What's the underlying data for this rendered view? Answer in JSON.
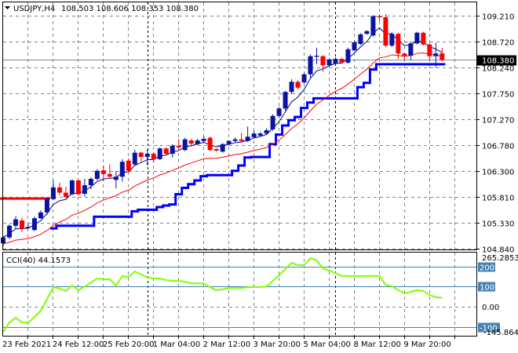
{
  "header": {
    "symbol": "USDJPY,H4",
    "ohlc": "108.503 108.606 108.353 108.380",
    "menu_icon": "triangle-down-icon"
  },
  "colors": {
    "bull": "#0a14a0",
    "bear": "#ff0000",
    "fast_ma": "#000080",
    "slow_ma": "#ff0000",
    "stop_lower": "#0000ff",
    "stop_upper": "#ff0000",
    "cci": "#80ff00",
    "level": "#4682b4",
    "grid": "#7a8594",
    "price_line": "#7a8a9a"
  },
  "chart_data": [
    {
      "type": "candlestick",
      "title": "USDJPY,H4",
      "ylim": [
        104.84,
        109.21
      ],
      "y_ticks": [
        "109.210",
        "108.720",
        "108.240",
        "107.750",
        "107.270",
        "106.780",
        "106.300",
        "105.810",
        "105.330",
        "104.840"
      ],
      "current_price": "108.380",
      "x_labels": [
        {
          "index": 0,
          "text": "23 Feb 2021"
        },
        {
          "index": 8,
          "text": "24 Feb 12:00"
        },
        {
          "index": 16,
          "text": "25 Feb 20:00"
        },
        {
          "index": 24,
          "text": "1 Mar 04:00"
        },
        {
          "index": 32,
          "text": "2 Mar 12:00"
        },
        {
          "index": 40,
          "text": "3 Mar 20:00"
        },
        {
          "index": 48,
          "text": "5 Mar 04:00"
        },
        {
          "index": 56,
          "text": "8 Mar 12:00"
        },
        {
          "index": 64,
          "text": "9 Mar 20:00"
        }
      ],
      "period_separators": [
        23,
        53
      ],
      "candles_ohlc": [
        [
          104.94,
          105.08,
          104.88,
          105.05
        ],
        [
          105.05,
          105.3,
          105.02,
          105.27
        ],
        [
          105.27,
          105.45,
          105.22,
          105.39
        ],
        [
          105.37,
          105.42,
          105.15,
          105.22
        ],
        [
          105.23,
          105.3,
          105.21,
          105.25
        ],
        [
          105.19,
          105.44,
          105.17,
          105.41
        ],
        [
          105.41,
          105.56,
          105.4,
          105.52
        ],
        [
          105.52,
          105.8,
          105.48,
          105.78
        ],
        [
          105.77,
          106.12,
          105.75,
          105.99
        ],
        [
          105.99,
          106.08,
          105.85,
          105.89
        ],
        [
          105.89,
          106.0,
          105.79,
          105.81
        ],
        [
          105.86,
          106.14,
          105.84,
          106.12
        ],
        [
          106.12,
          106.14,
          105.84,
          105.86
        ],
        [
          105.87,
          106.15,
          105.82,
          106.03
        ],
        [
          106.03,
          106.18,
          105.95,
          106.15
        ],
        [
          106.15,
          106.33,
          106.12,
          106.3
        ],
        [
          106.31,
          106.4,
          106.1,
          106.24
        ],
        [
          106.24,
          106.42,
          106.15,
          106.19
        ],
        [
          106.13,
          106.3,
          105.97,
          106.19
        ],
        [
          106.19,
          106.52,
          106.1,
          106.47
        ],
        [
          106.49,
          106.53,
          106.27,
          106.3
        ],
        [
          106.42,
          106.7,
          106.4,
          106.64
        ],
        [
          106.64,
          106.66,
          106.47,
          106.56
        ],
        [
          106.56,
          106.7,
          106.4,
          106.62
        ],
        [
          106.62,
          106.65,
          106.45,
          106.52
        ],
        [
          106.52,
          106.74,
          106.5,
          106.72
        ],
        [
          106.72,
          106.74,
          106.6,
          106.62
        ],
        [
          106.62,
          106.8,
          106.55,
          106.77
        ],
        [
          106.77,
          106.9,
          106.7,
          106.74
        ],
        [
          106.69,
          106.92,
          106.67,
          106.89
        ],
        [
          106.87,
          106.9,
          106.75,
          106.81
        ],
        [
          106.8,
          106.9,
          106.78,
          106.87
        ],
        [
          106.86,
          106.95,
          106.84,
          106.9
        ],
        [
          106.92,
          106.94,
          106.67,
          106.69
        ],
        [
          106.71,
          106.72,
          106.66,
          106.68
        ],
        [
          106.66,
          106.82,
          106.64,
          106.8
        ],
        [
          106.8,
          106.88,
          106.78,
          106.86
        ],
        [
          106.86,
          106.93,
          106.84,
          106.89
        ],
        [
          106.89,
          107.01,
          106.84,
          106.86
        ],
        [
          106.86,
          107.13,
          106.84,
          106.94
        ],
        [
          106.93,
          107.05,
          106.91,
          107.0
        ],
        [
          106.96,
          107.03,
          106.94,
          107.0
        ],
        [
          107.0,
          107.1,
          106.98,
          107.06
        ],
        [
          107.08,
          107.36,
          107.05,
          107.33
        ],
        [
          107.33,
          107.5,
          107.3,
          107.47
        ],
        [
          107.47,
          107.8,
          107.43,
          107.78
        ],
        [
          107.78,
          108.02,
          107.74,
          107.97
        ],
        [
          107.97,
          108.0,
          107.82,
          107.86
        ],
        [
          107.96,
          108.14,
          107.93,
          108.11
        ],
        [
          108.11,
          108.48,
          108.05,
          108.45
        ],
        [
          108.44,
          108.61,
          108.3,
          108.46
        ],
        [
          108.45,
          108.47,
          108.16,
          108.28
        ],
        [
          108.28,
          108.41,
          108.26,
          108.39
        ],
        [
          108.31,
          108.43,
          108.29,
          108.4
        ],
        [
          108.4,
          108.42,
          108.31,
          108.33
        ],
        [
          108.33,
          108.61,
          108.31,
          108.58
        ],
        [
          108.56,
          108.74,
          108.54,
          108.71
        ],
        [
          108.68,
          108.88,
          108.66,
          108.86
        ],
        [
          108.87,
          108.94,
          108.85,
          108.92
        ],
        [
          108.84,
          109.22,
          108.82,
          109.2
        ],
        [
          109.2,
          109.24,
          109.1,
          109.18
        ],
        [
          109.18,
          109.24,
          108.62,
          108.65
        ],
        [
          108.65,
          108.9,
          108.62,
          108.87
        ],
        [
          108.87,
          108.89,
          108.4,
          108.5
        ],
        [
          108.5,
          108.52,
          108.38,
          108.46
        ],
        [
          108.46,
          108.72,
          108.38,
          108.69
        ],
        [
          108.69,
          108.91,
          108.67,
          108.89
        ],
        [
          108.89,
          108.91,
          108.65,
          108.67
        ],
        [
          108.67,
          108.69,
          108.38,
          108.45
        ],
        [
          108.45,
          108.7,
          108.24,
          108.5
        ],
        [
          108.503,
          108.606,
          108.353,
          108.38
        ]
      ],
      "stop_upper": [
        105.78,
        105.78,
        105.78,
        105.78,
        105.78,
        105.78,
        105.78,
        105.78
      ],
      "stop_lower": [
        null,
        null,
        null,
        null,
        null,
        null,
        null,
        null,
        105.22,
        105.27,
        105.27,
        105.27,
        105.27,
        105.27,
        105.27,
        105.44,
        105.44,
        105.44,
        105.44,
        105.44,
        105.44,
        105.54,
        105.57,
        105.57,
        105.57,
        105.62,
        105.65,
        105.67,
        105.86,
        105.98,
        106.05,
        106.12,
        106.2,
        106.22,
        106.22,
        106.22,
        106.22,
        106.3,
        106.4,
        106.55,
        106.56,
        106.56,
        106.56,
        106.8,
        106.98,
        107.15,
        107.25,
        107.31,
        107.48,
        107.58,
        107.66,
        107.66,
        107.66,
        107.66,
        107.66,
        107.66,
        107.66,
        107.87,
        107.95,
        108.2,
        108.3,
        108.3,
        108.3,
        108.3,
        108.3,
        108.3,
        108.3,
        108.3,
        108.3,
        108.3,
        108.3
      ]
    },
    {
      "type": "line",
      "title": "CCI(40)",
      "current_value": "44.1573",
      "ylim": [
        -145.8641,
        265.2853
      ],
      "axis_max_label": "265.2853",
      "axis_min_label": "-145.8641",
      "zero_label": "0.00",
      "levels": [
        {
          "value": 200,
          "text": "200"
        },
        {
          "value": 100,
          "text": "100"
        },
        {
          "value": -100,
          "text": "-100"
        }
      ],
      "values": [
        -125,
        -78,
        -55,
        -78,
        -80,
        -50,
        -20,
        38,
        97,
        90,
        78,
        105,
        82,
        100,
        120,
        140,
        136,
        136,
        105,
        152,
        148,
        175,
        160,
        145,
        140,
        140,
        132,
        128,
        128,
        124,
        116,
        116,
        116,
        97,
        82,
        86,
        93,
        93,
        93,
        97,
        98,
        98,
        100,
        128,
        155,
        187,
        218,
        206,
        206,
        241,
        230,
        190,
        179,
        167,
        152,
        152,
        152,
        152,
        152,
        152,
        152,
        109,
        101,
        82,
        66,
        74,
        82,
        78,
        58,
        47,
        44.1573
      ]
    }
  ]
}
